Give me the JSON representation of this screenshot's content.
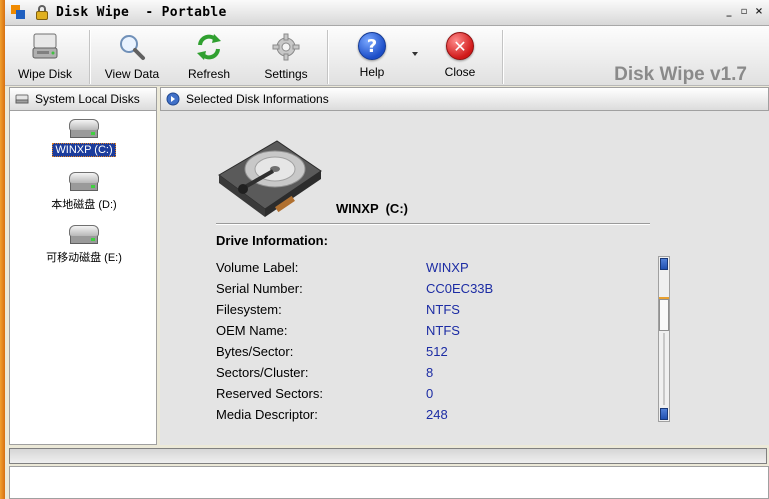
{
  "window": {
    "title": "Disk Wipe  - Portable",
    "controls": [
      "_",
      "▫",
      "×"
    ]
  },
  "toolbar": {
    "buttons": [
      {
        "label": "Wipe Disk",
        "icon": "drive-icon"
      },
      {
        "label": "View Data",
        "icon": "magnifier-icon"
      },
      {
        "label": "Refresh",
        "icon": "refresh-icon"
      },
      {
        "label": "Settings",
        "icon": "gear-icon"
      },
      {
        "label": "Help",
        "icon": "help-icon"
      },
      {
        "label": "Close",
        "icon": "close-icon"
      }
    ],
    "brand": "Disk Wipe v1.7"
  },
  "left_panel": {
    "header": "System Local Disks",
    "disks": [
      {
        "name": "WINXP (C:)",
        "selected": true
      },
      {
        "name": "本地磁盘 (D:)",
        "selected": false
      },
      {
        "name": "可移动磁盘 (E:)",
        "selected": false
      }
    ]
  },
  "right_panel": {
    "header": "Selected Disk Informations",
    "drive_title": "WINXP  (C:)",
    "section_title": "Drive Information:",
    "rows": [
      {
        "key": "Volume Label:",
        "value": "WINXP"
      },
      {
        "key": "Serial Number:",
        "value": "CC0EC33B"
      },
      {
        "key": "Filesystem:",
        "value": "NTFS"
      },
      {
        "key": "OEM Name:",
        "value": "NTFS"
      },
      {
        "key": "Bytes/Sector:",
        "value": "512"
      },
      {
        "key": "Sectors/Cluster:",
        "value": "8"
      },
      {
        "key": "Reserved Sectors:",
        "value": "0"
      },
      {
        "key": "Media Descriptor:",
        "value": "248"
      }
    ]
  },
  "colors": {
    "accent": "#e08020",
    "value_text": "#1c2ca4",
    "selection": "#1c3c9c"
  }
}
